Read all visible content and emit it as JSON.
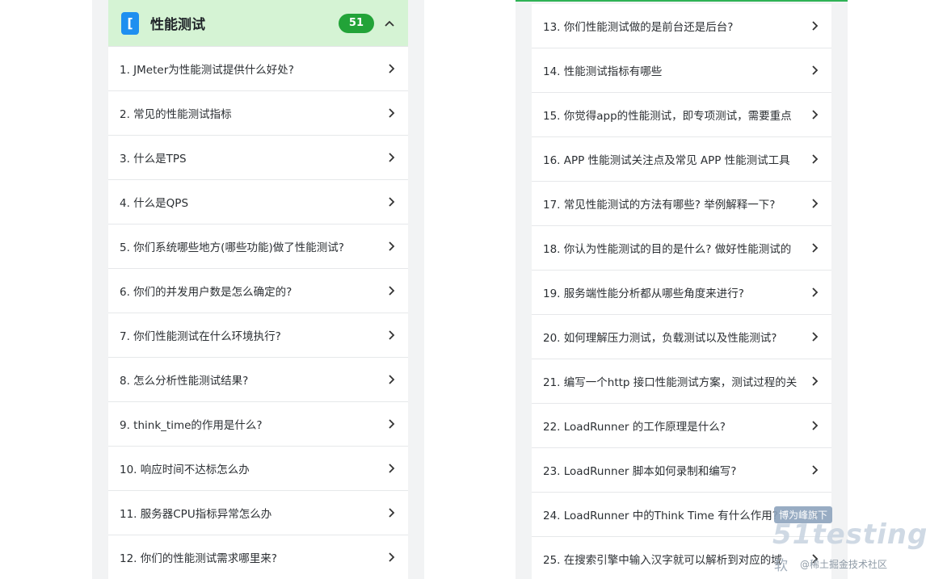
{
  "left": {
    "header": {
      "icon_char": "[",
      "title": "性能测试",
      "count": "51"
    },
    "items": [
      "1. JMeter为性能测试提供什么好处?",
      "2. 常见的性能测试指标",
      "3. 什么是TPS",
      "4. 什么是QPS",
      "5. 你们系统哪些地方(哪些功能)做了性能测试?",
      "6. 你们的并发用户数是怎么确定的?",
      "7. 你们性能测试在什么环境执行?",
      "8. 怎么分析性能测试结果?",
      "9. think_time的作用是什么?",
      "10. 响应时间不达标怎么办",
      "11. 服务器CPU指标异常怎么办",
      "12. 你们的性能测试需求哪里来?"
    ]
  },
  "right": {
    "items": [
      "13. 你们性能测试做的是前台还是后台?",
      "14. 性能测试指标有哪些",
      "15. 你觉得app的性能测试，即专项测试，需要重点",
      "16. APP 性能测试关注点及常见 APP 性能测试工具",
      "17. 常见性能测试的方法有哪些? 举例解释一下?",
      "18. 你认为性能测试的目的是什么? 做好性能测试的",
      "19. 服务端性能分析都从哪些角度来进行?",
      "20. 如何理解压力测试，负载测试以及性能测试?",
      "21. 编写一个http 接口性能测试方案，测试过程的关",
      "22. LoadRunner 的工作原理是什么?",
      "23. LoadRunner 脚本如何录制和编写?",
      "24. LoadRunner 中的Think Time 有什么作用?",
      "25. 在搜索引擎中输入汉字就可以解析到对应的域"
    ]
  },
  "watermark": {
    "badge": "博为峰旗下",
    "logo": "51testing",
    "cn": "软",
    "site": "@稀土掘金技术社区"
  },
  "colors": {
    "accent": "#22a338",
    "header_bg": "#d5f3d4",
    "icon_blue": "#1f8ff0"
  }
}
